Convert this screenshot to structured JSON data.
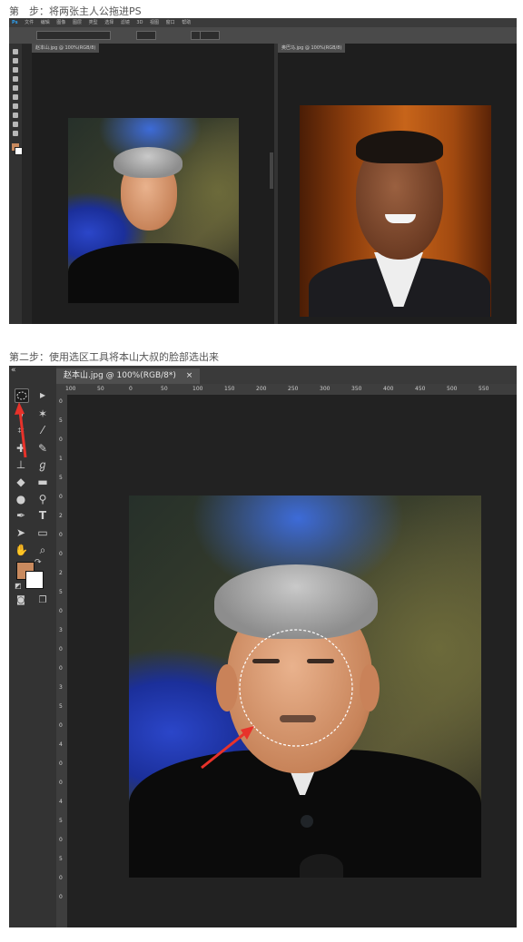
{
  "step1": {
    "caption": "第　步：将两张主人公拖进PS",
    "menubar": [
      "Ps",
      "文件",
      "编辑",
      "图像",
      "图层",
      "类型",
      "选择",
      "滤镜",
      "3D",
      "视图",
      "窗口",
      "帮助"
    ],
    "doc1_tab": "赵本山.jpg @ 100%(RGB/8)",
    "doc2_tab": "奥巴马.jpg @ 100%(RGB/8)"
  },
  "step2": {
    "caption": "第二步：使用选区工具将本山大叔的脸部选出来",
    "tab_title": "赵本山.jpg @ 100%(RGB/8*)",
    "tab_close": "×",
    "collapse": "«",
    "ruler_top": [
      "100",
      "50",
      "0",
      "50",
      "100",
      "150",
      "200",
      "250",
      "300",
      "350",
      "400",
      "450",
      "500",
      "550"
    ],
    "ruler_left": [
      "0",
      "5",
      "0",
      "1",
      "5",
      "0",
      "2",
      "0",
      "0",
      "2",
      "5",
      "0",
      "3",
      "0",
      "0",
      "3",
      "5",
      "0",
      "4",
      "0",
      "0",
      "4",
      "5",
      "0",
      "5",
      "0",
      "0"
    ]
  },
  "colors": {
    "foreground": "#c98a5e",
    "background": "#ffffff",
    "selection": "#ffffff",
    "arrow": "#e8322a"
  },
  "icons": [
    "ellipse-marquee-icon",
    "move-icon",
    "lasso-icon",
    "magic-wand-icon",
    "crop-icon",
    "eyedropper-icon",
    "healing-icon",
    "brush-icon",
    "stamp-icon",
    "history-brush-icon",
    "eraser-icon",
    "gradient-icon",
    "blur-icon",
    "dodge-icon",
    "pen-icon",
    "type-icon",
    "path-select-icon",
    "rectangle-icon",
    "hand-icon",
    "zoom-icon",
    "quick-mask-icon",
    "screen-mode-icon"
  ]
}
